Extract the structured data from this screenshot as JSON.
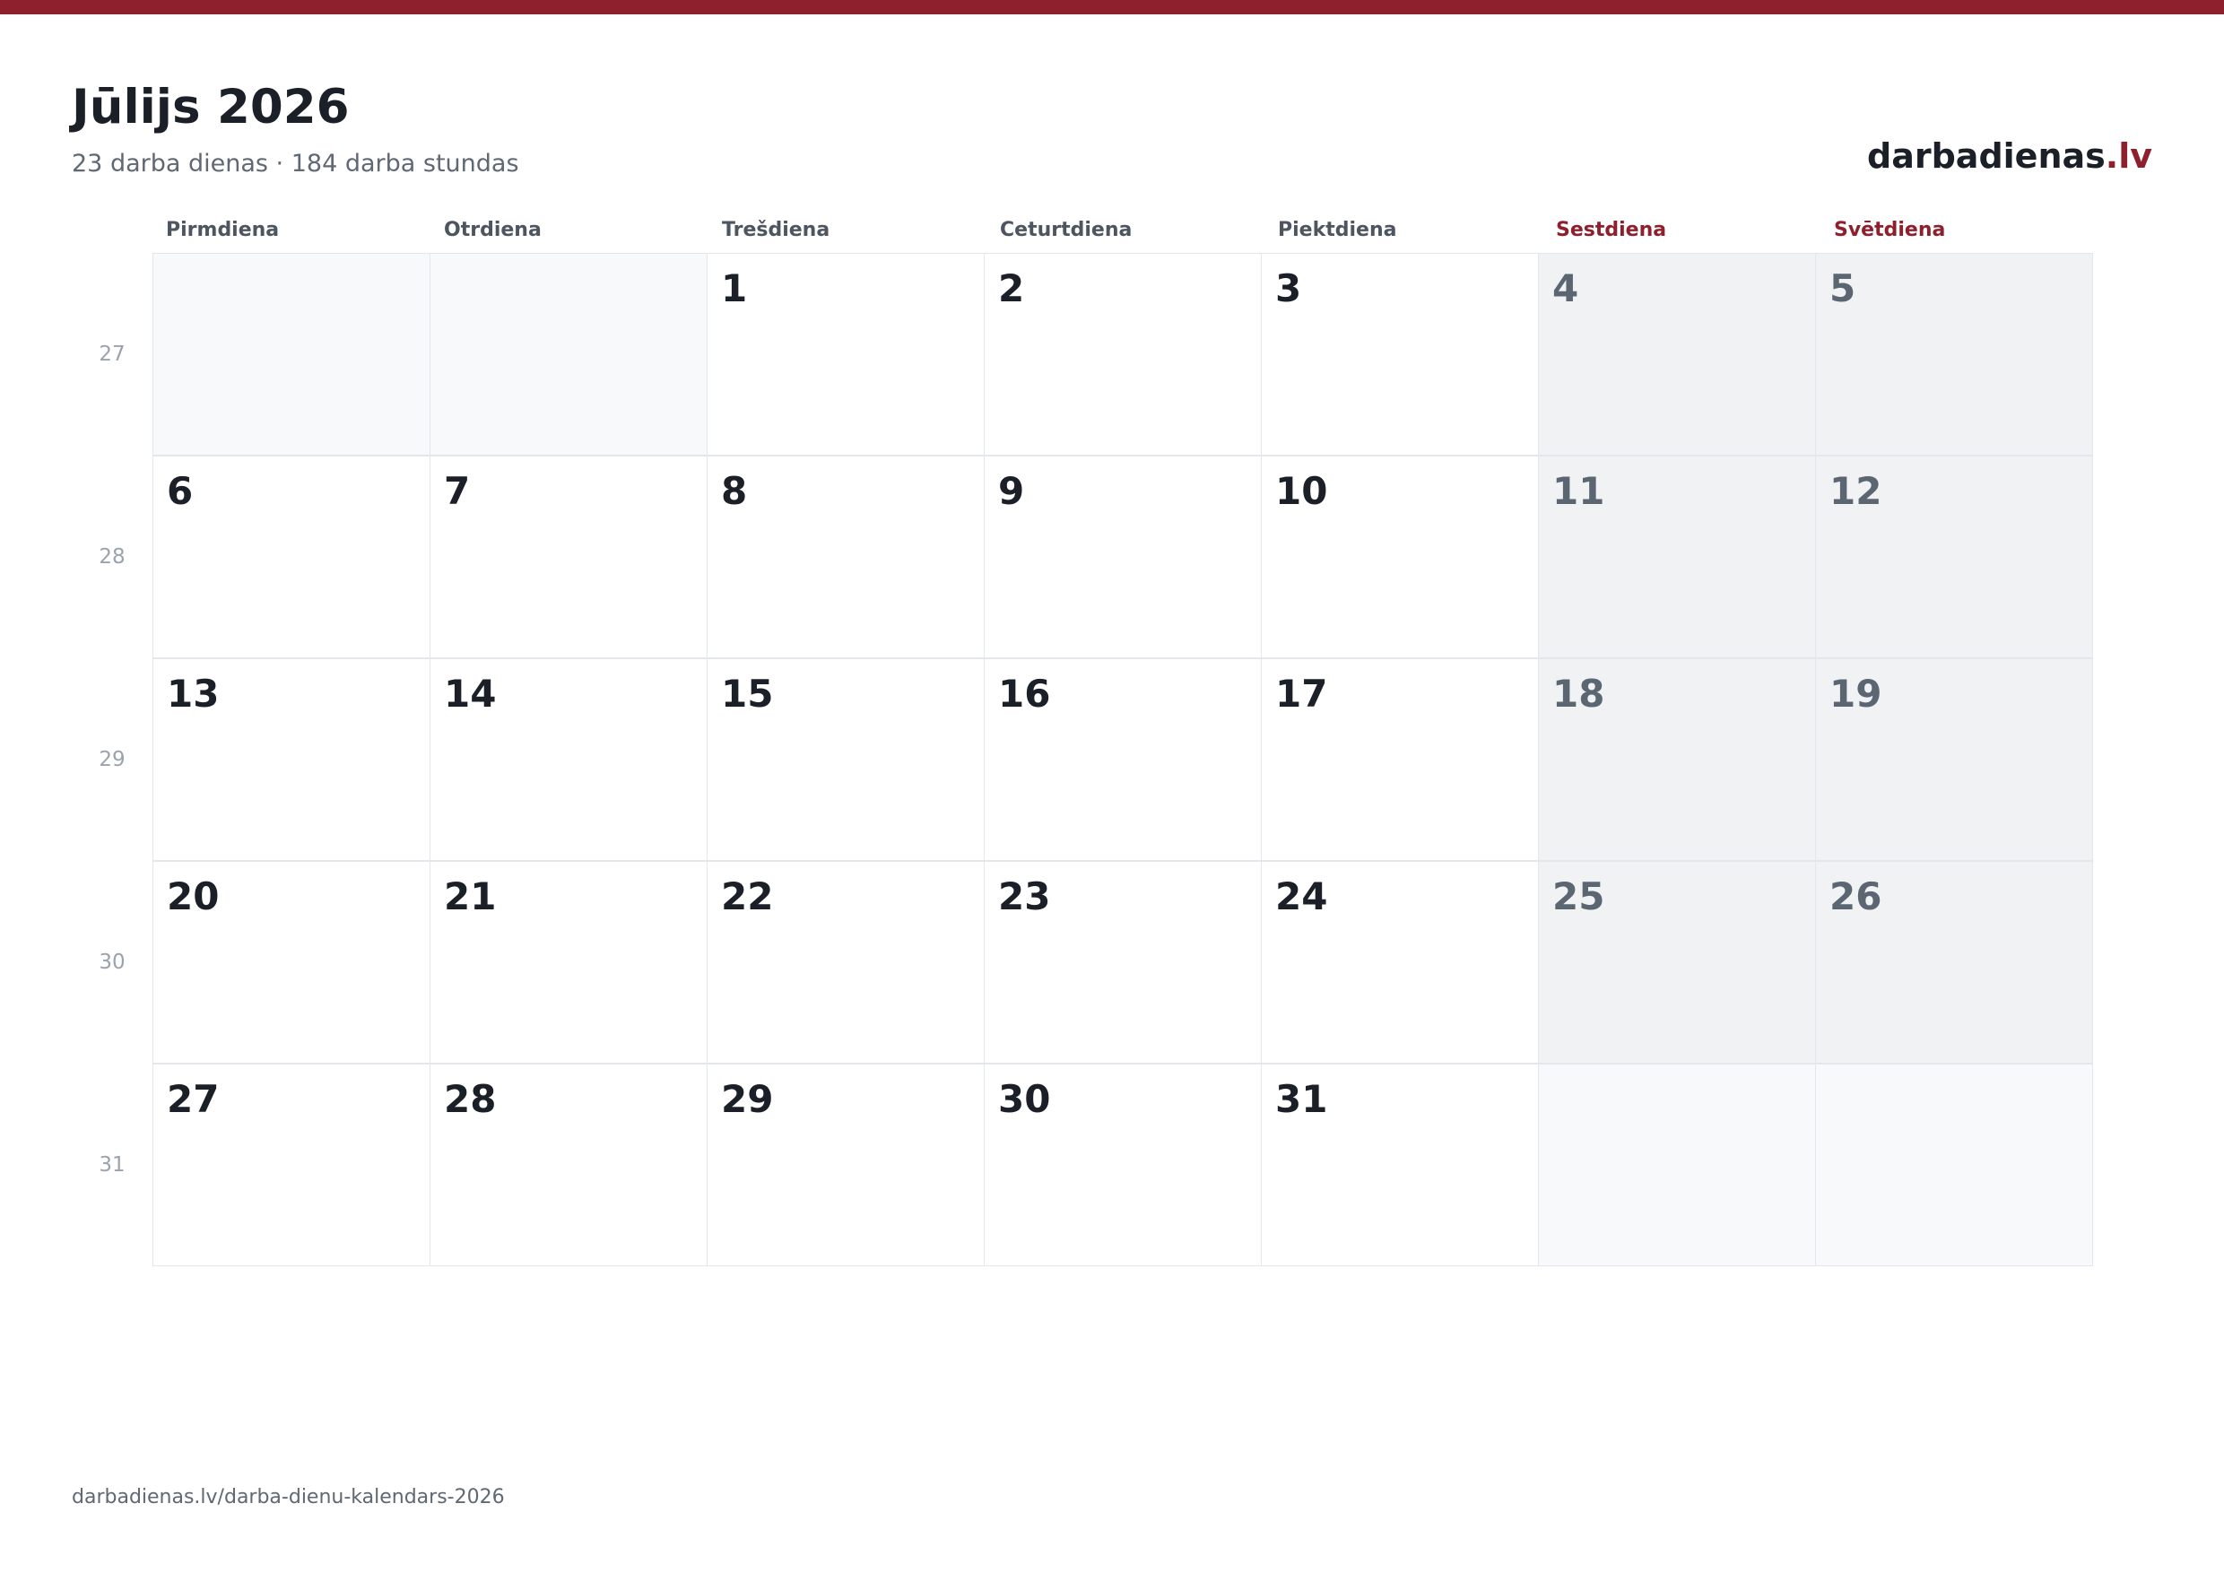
{
  "header": {
    "title": "Jūlijs 2026",
    "subtitle": "23 darba dienas · 184 darba stundas",
    "brand_name": "darbadienas",
    "brand_tld": ".lv"
  },
  "colors": {
    "accent": "#8e1f2d",
    "text": "#1b1f27",
    "muted": "#5f6873",
    "weekend_bg": "#f0f2f4",
    "empty_bg": "#f8f9fb",
    "border": "#e3e6ea"
  },
  "calendar": {
    "weekdays": [
      "Pirmdiena",
      "Otrdiena",
      "Trešdiena",
      "Ceturtdiena",
      "Piektdiena",
      "Sestdiena",
      "Svētdiena"
    ],
    "weekend_columns": [
      5,
      6
    ],
    "weeks": [
      {
        "number": "27",
        "days": [
          "",
          "",
          "1",
          "2",
          "3",
          "4",
          "5"
        ]
      },
      {
        "number": "28",
        "days": [
          "6",
          "7",
          "8",
          "9",
          "10",
          "11",
          "12"
        ]
      },
      {
        "number": "29",
        "days": [
          "13",
          "14",
          "15",
          "16",
          "17",
          "18",
          "19"
        ]
      },
      {
        "number": "30",
        "days": [
          "20",
          "21",
          "22",
          "23",
          "24",
          "25",
          "26"
        ]
      },
      {
        "number": "31",
        "days": [
          "27",
          "28",
          "29",
          "30",
          "31",
          "",
          ""
        ]
      }
    ]
  },
  "footer": {
    "url": "darbadienas.lv/darba-dienu-kalendars-2026"
  }
}
